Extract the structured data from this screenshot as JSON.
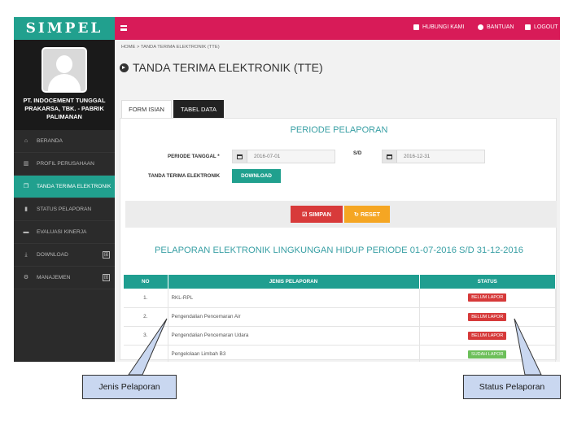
{
  "brand": {
    "name": "SIMPEL",
    "color": "#21a08e"
  },
  "profile": {
    "company": "PT. INDOCEMENT TUNGGAL PRAKARSA, TBK. - PABRIK PALIMANAN"
  },
  "sidebar": {
    "items": [
      {
        "label": "BERANDA",
        "icon": "home-icon"
      },
      {
        "label": "PROFIL PERUSAHAAN",
        "icon": "bank-icon"
      },
      {
        "label": "TANDA TERIMA ELEKTRONIK",
        "icon": "copy-icon",
        "active": true
      },
      {
        "label": "STATUS PELAPORAN",
        "icon": "bookmark-icon"
      },
      {
        "label": "EVALUASI KINERJA",
        "icon": "briefcase-icon"
      },
      {
        "label": "DOWNLOAD",
        "icon": "download-icon",
        "expand": "⊞"
      },
      {
        "label": "MANAJEMEN",
        "icon": "cogs-icon",
        "expand": "⊞"
      }
    ]
  },
  "topbar": {
    "color": "#d81b58",
    "links": [
      {
        "label": "HUBUNGI KAMI",
        "icon": "contact-icon"
      },
      {
        "label": "BANTUAN",
        "icon": "help-icon"
      },
      {
        "label": "LOGOUT",
        "icon": "logout-icon"
      }
    ]
  },
  "breadcrumb": "HOME  >  TANDA TERIMA ELEKTRONIK (TTE)",
  "page_title": "TANDA TERIMA ELEKTRONIK (TTE)",
  "tabs": [
    {
      "label": "FORM ISIAN"
    },
    {
      "label": "TABEL DATA",
      "active": true
    }
  ],
  "form": {
    "section_title": "PERIODE PELAPORAN",
    "periode_label": "PERIODE TANGGAL *",
    "start_date": "2016-07-01",
    "sd_label": "S/D",
    "end_date": "2016-12-31",
    "tte_label": "TANDA TERIMA ELEKTRONIK",
    "download_label": "DOWNLOAD",
    "simpan_label": "SIMPAN",
    "reset_label": "RESET"
  },
  "report": {
    "title": "PELAPORAN ELEKTRONIK LINGKUNGAN HIDUP PERIODE 01-07-2016 S/D 31-12-2016",
    "columns": [
      "NO",
      "JENIS PELAPORAN",
      "STATUS"
    ],
    "rows": [
      {
        "no": "1.",
        "jenis": "RKL-RPL",
        "status": "BELUM LAPOR",
        "color": "#d63a3a"
      },
      {
        "no": "2.",
        "jenis": "Pengendalian Pencemaran Air",
        "status": "BELUM LAPOR",
        "color": "#d63a3a"
      },
      {
        "no": "3.",
        "jenis": "Pengendalian Pencemaran Udara",
        "status": "BELUM LAPOR",
        "color": "#d63a3a"
      },
      {
        "no": "4.",
        "jenis": "Pengelolaan Limbah B3",
        "status": "SUDAH LAPOR",
        "color": "#6cbf5a"
      }
    ]
  },
  "callouts": {
    "jenis": "Jenis Pelaporan",
    "status": "Status Pelaporan"
  }
}
